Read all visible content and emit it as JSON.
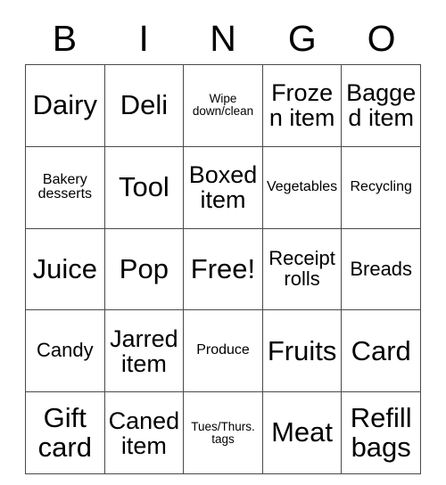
{
  "card": {
    "title_letters": [
      "B",
      "I",
      "N",
      "G",
      "O"
    ],
    "columns": 5,
    "rows": 5,
    "free_space_label": "Free!",
    "free_space_position": {
      "row": 3,
      "column": 3
    },
    "border_color": "#4a4a4a",
    "text_color": "#000000",
    "background_color": "#ffffff"
  },
  "grid": {
    "rows": [
      {
        "cells": [
          {
            "text": "Dairy",
            "size": "xl"
          },
          {
            "text": "Deli",
            "size": "xl"
          },
          {
            "text": "Wipe down/clean",
            "size": "xs"
          },
          {
            "text": "Frozen item",
            "size": "lg"
          },
          {
            "text": "Bagged item",
            "size": "lg"
          }
        ]
      },
      {
        "cells": [
          {
            "text": "Bakery desserts",
            "size": "sm"
          },
          {
            "text": "Tool",
            "size": "xl"
          },
          {
            "text": "Boxed item",
            "size": "lg"
          },
          {
            "text": "Vegetables",
            "size": "sm"
          },
          {
            "text": "Recycling",
            "size": "sm"
          }
        ]
      },
      {
        "cells": [
          {
            "text": "Juice",
            "size": "xl"
          },
          {
            "text": "Pop",
            "size": "xl"
          },
          {
            "text": "Free!",
            "size": "xl"
          },
          {
            "text": "Receipt rolls",
            "size": "md"
          },
          {
            "text": "Breads",
            "size": "md"
          }
        ]
      },
      {
        "cells": [
          {
            "text": "Candy",
            "size": "md"
          },
          {
            "text": "Jarred item",
            "size": "lg"
          },
          {
            "text": "Produce",
            "size": "sm"
          },
          {
            "text": "Fruits",
            "size": "xl"
          },
          {
            "text": "Card",
            "size": "xl"
          }
        ]
      },
      {
        "cells": [
          {
            "text": "Gift card",
            "size": "xl"
          },
          {
            "text": "Caned item",
            "size": "lg"
          },
          {
            "text": "Tues/Thurs. tags",
            "size": "xs"
          },
          {
            "text": "Meat",
            "size": "xl"
          },
          {
            "text": "Refill bags",
            "size": "xl"
          }
        ]
      }
    ]
  }
}
